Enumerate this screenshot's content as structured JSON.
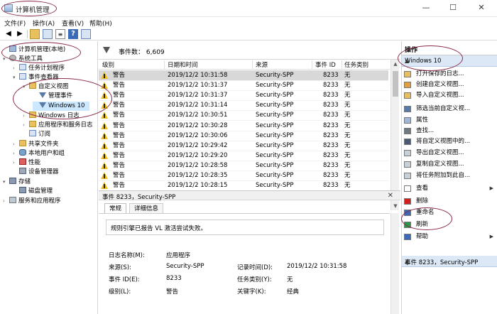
{
  "window": {
    "title": "计算机管理",
    "minimize": "—",
    "maximize": "☐",
    "close": "✕"
  },
  "menu": [
    "文件(F)",
    "操作(A)",
    "查看(V)",
    "帮助(H)"
  ],
  "tree": [
    {
      "label": "计算机管理(本地)",
      "icon": "computer-icon"
    },
    {
      "label": "系统工具",
      "icon": "tools-icon"
    },
    {
      "label": "任务计划程序",
      "icon": "scheduler-icon"
    },
    {
      "label": "事件查看器",
      "icon": "event-viewer-icon"
    },
    {
      "label": "自定义视图",
      "icon": "folder-icon"
    },
    {
      "label": "管理事件",
      "icon": "filter-icon"
    },
    {
      "label": "Windows 10",
      "icon": "filter-icon"
    },
    {
      "label": "Windows 日志",
      "icon": "folder-icon"
    },
    {
      "label": "应用程序和服务日志",
      "icon": "folder-icon"
    },
    {
      "label": "订阅",
      "icon": "log-icon"
    },
    {
      "label": "共享文件夹",
      "icon": "folder-icon"
    },
    {
      "label": "本地用户和组",
      "icon": "users-icon"
    },
    {
      "label": "性能",
      "icon": "performance-icon"
    },
    {
      "label": "设备管理器",
      "icon": "device-icon"
    },
    {
      "label": "存储",
      "icon": "storage-icon"
    },
    {
      "label": "磁盘管理",
      "icon": "disk-icon"
    },
    {
      "label": "服务和应用程序",
      "icon": "services-icon"
    }
  ],
  "events": {
    "header_label": "事件数：",
    "count": "6,609",
    "columns": [
      "级别",
      "日期和时间",
      "来源",
      "事件 ID",
      "任务类别"
    ],
    "rows": [
      {
        "level": "警告",
        "datetime": "2019/12/2 10:31:58",
        "source": "Security-SPP",
        "id": "8233",
        "category": "无"
      },
      {
        "level": "警告",
        "datetime": "2019/12/2 10:31:37",
        "source": "Security-SPP",
        "id": "8233",
        "category": "无"
      },
      {
        "level": "警告",
        "datetime": "2019/12/2 10:31:37",
        "source": "Security-SPP",
        "id": "8233",
        "category": "无"
      },
      {
        "level": "警告",
        "datetime": "2019/12/2 10:31:14",
        "source": "Security-SPP",
        "id": "8233",
        "category": "无"
      },
      {
        "level": "警告",
        "datetime": "2019/12/2 10:30:51",
        "source": "Security-SPP",
        "id": "8233",
        "category": "无"
      },
      {
        "level": "警告",
        "datetime": "2019/12/2 10:30:28",
        "source": "Security-SPP",
        "id": "8233",
        "category": "无"
      },
      {
        "level": "警告",
        "datetime": "2019/12/2 10:30:06",
        "source": "Security-SPP",
        "id": "8233",
        "category": "无"
      },
      {
        "level": "警告",
        "datetime": "2019/12/2 10:29:42",
        "source": "Security-SPP",
        "id": "8233",
        "category": "无"
      },
      {
        "level": "警告",
        "datetime": "2019/12/2 10:29:20",
        "source": "Security-SPP",
        "id": "8233",
        "category": "无"
      },
      {
        "level": "警告",
        "datetime": "2019/12/2 10:28:58",
        "source": "Security-SPP",
        "id": "8233",
        "category": "无"
      },
      {
        "level": "警告",
        "datetime": "2019/12/2 10:28:35",
        "source": "Security-SPP",
        "id": "8233",
        "category": "无"
      },
      {
        "level": "警告",
        "datetime": "2019/12/2 10:28:15",
        "source": "Security-SPP",
        "id": "8233",
        "category": "无"
      }
    ]
  },
  "detail": {
    "title": "事件 8233，Security-SPP",
    "close": "✕",
    "tabs": [
      "常规",
      "详细信息"
    ],
    "message": "规则引擎已报告 VL 激活尝试失败。",
    "fields": {
      "log_name_label": "日志名称(M):",
      "log_name": "应用程序",
      "source_label": "来源(S):",
      "source": "Security-SPP",
      "logged_label": "记录时间(D):",
      "logged": "2019/12/2 10:31:58",
      "event_id_label": "事件 ID(E):",
      "event_id": "8233",
      "task_label": "任务类别(Y):",
      "task": "无",
      "level_label": "级别(L):",
      "level": "警告",
      "keywords_label": "关键字(K):",
      "keywords": "经典"
    }
  },
  "actions": {
    "header": "操作",
    "section1": "Windows 10",
    "items": [
      {
        "label": "打开保存的日志...",
        "icon": "open-log-icon"
      },
      {
        "label": "创建自定义视图...",
        "icon": "create-view-icon"
      },
      {
        "label": "导入自定义视图...",
        "icon": "import-view-icon"
      },
      {
        "label": "筛选当前自定义视...",
        "icon": "filter-icon"
      },
      {
        "label": "属性",
        "icon": "properties-icon"
      },
      {
        "label": "查找...",
        "icon": "find-icon"
      },
      {
        "label": "将自定义视图中的...",
        "icon": "save-icon"
      },
      {
        "label": "导出自定义视图...",
        "icon": "export-icon"
      },
      {
        "label": "复制自定义视图...",
        "icon": "copy-icon"
      },
      {
        "label": "将任务附加到此自...",
        "icon": "attach-task-icon"
      },
      {
        "label": "查看",
        "icon": "view-icon",
        "submenu": true
      },
      {
        "label": "删除",
        "icon": "delete-icon"
      },
      {
        "label": "重命名",
        "icon": "rename-icon"
      },
      {
        "label": "刷新",
        "icon": "refresh-icon"
      },
      {
        "label": "帮助",
        "icon": "help-icon",
        "submenu": true
      }
    ],
    "section2": "事件 8233，Security-SPP"
  },
  "colors": {
    "selection": "#cce8ff",
    "action_section": "#dce8f6",
    "annotation": "#8a2a48",
    "warning": "#f0c020"
  }
}
